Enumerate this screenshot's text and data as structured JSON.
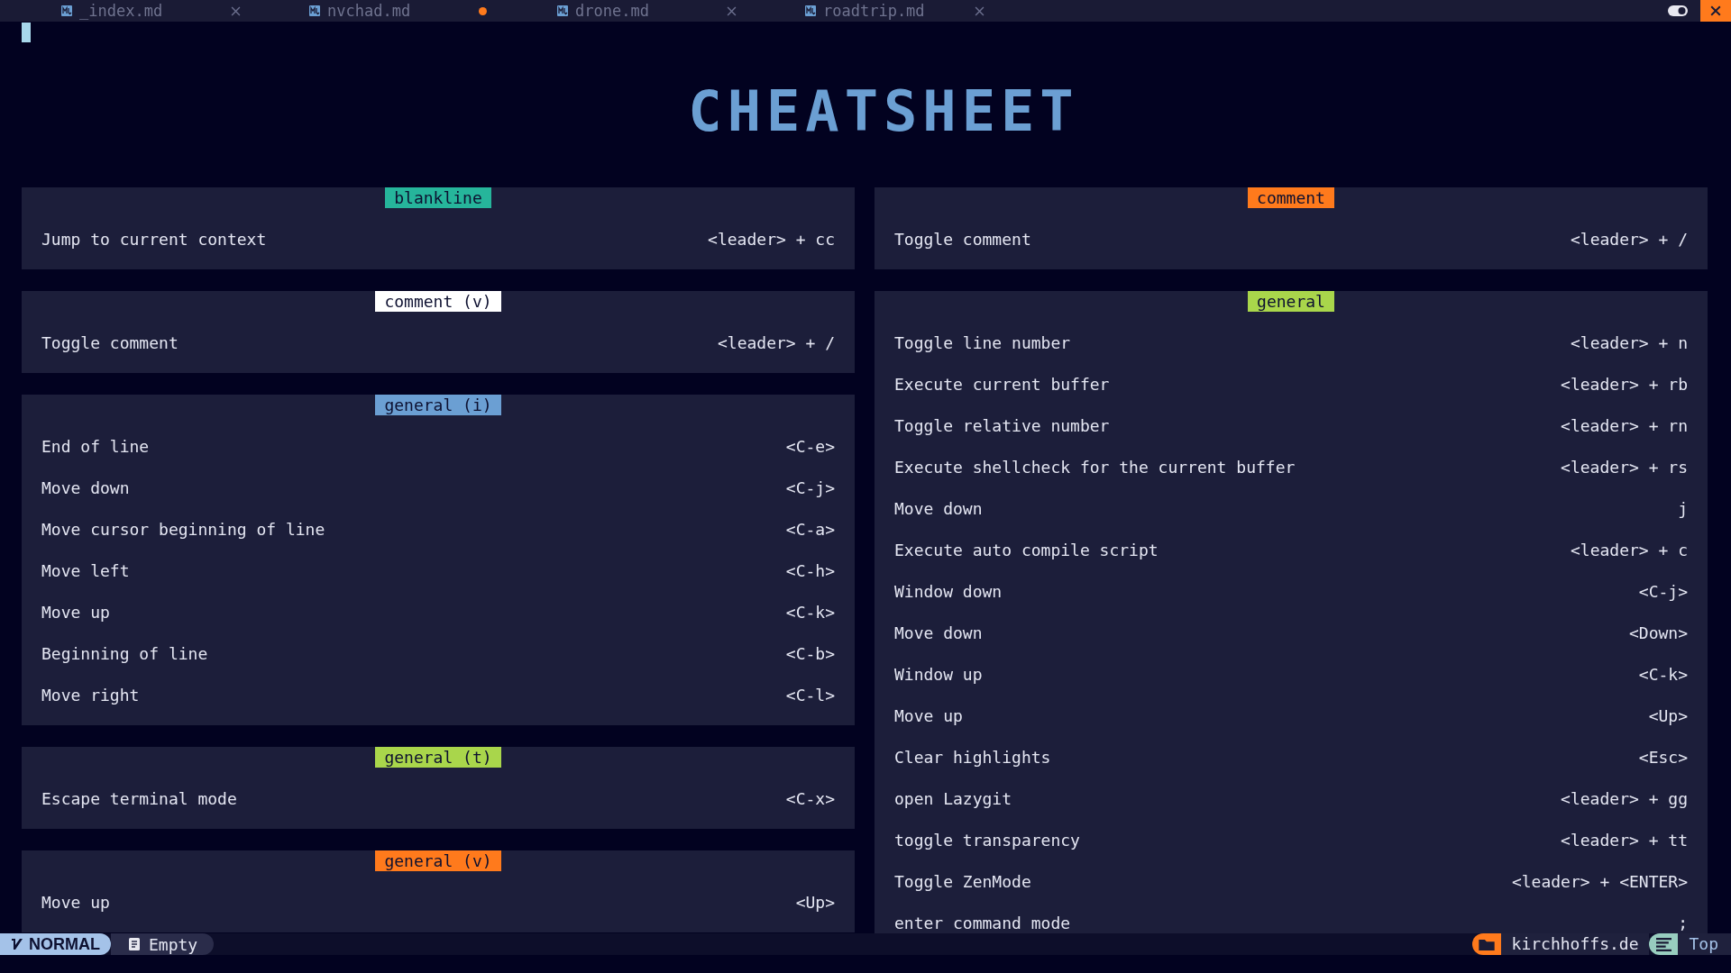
{
  "tabs": [
    {
      "label": "_index.md",
      "modified": false
    },
    {
      "label": "nvchad.md",
      "modified": true
    },
    {
      "label": "drone.md",
      "modified": false
    },
    {
      "label": "roadtrip.md",
      "modified": false
    }
  ],
  "title": "CHEATSHEET",
  "columns": [
    [
      {
        "header": "blankline",
        "color": "#26b59b",
        "rows": [
          {
            "action": "Jump to current context",
            "keys": "<leader> + cc"
          }
        ]
      },
      {
        "header": "comment (v)",
        "color": "#ffffff",
        "rows": [
          {
            "action": "Toggle comment",
            "keys": "<leader> + /"
          }
        ]
      },
      {
        "header": "general (i)",
        "color": "#6b9fd3",
        "rows": [
          {
            "action": "End of line",
            "keys": "<C-e>"
          },
          {
            "action": "Move down",
            "keys": "<C-j>"
          },
          {
            "action": "Move cursor beginning of line",
            "keys": "<C-a>"
          },
          {
            "action": "Move left",
            "keys": "<C-h>"
          },
          {
            "action": "Move up",
            "keys": "<C-k>"
          },
          {
            "action": "Beginning of line",
            "keys": "<C-b>"
          },
          {
            "action": "Move right",
            "keys": "<C-l>"
          }
        ]
      },
      {
        "header": "general (t)",
        "color": "#a9d64b",
        "rows": [
          {
            "action": "Escape terminal mode",
            "keys": "<C-x>"
          }
        ]
      },
      {
        "header": "general (v)",
        "color": "#ff7a1c",
        "rows": [
          {
            "action": "Move up",
            "keys": "<Up>"
          }
        ]
      }
    ],
    [
      {
        "header": "comment",
        "color": "#ff7a1c",
        "rows": [
          {
            "action": "Toggle comment",
            "keys": "<leader> + /"
          }
        ]
      },
      {
        "header": "general",
        "color": "#a9d64b",
        "rows": [
          {
            "action": "Toggle line number",
            "keys": "<leader> + n"
          },
          {
            "action": "Execute current buffer",
            "keys": "<leader> + rb"
          },
          {
            "action": "Toggle relative number",
            "keys": "<leader> + rn"
          },
          {
            "action": "Execute shellcheck for the current buffer",
            "keys": "<leader> + rs"
          },
          {
            "action": "Move down",
            "keys": "j"
          },
          {
            "action": "Execute auto compile script",
            "keys": "<leader> + c"
          },
          {
            "action": "Window down",
            "keys": "<C-j>"
          },
          {
            "action": "Move down",
            "keys": "<Down>"
          },
          {
            "action": "Window up",
            "keys": "<C-k>"
          },
          {
            "action": "Move up",
            "keys": "<Up>"
          },
          {
            "action": "Clear highlights",
            "keys": "<Esc>"
          },
          {
            "action": "open Lazygit",
            "keys": "<leader> + gg"
          },
          {
            "action": "toggle transparency",
            "keys": "<leader> + tt"
          },
          {
            "action": "Toggle ZenMode",
            "keys": "<leader> + <ENTER>"
          },
          {
            "action": "enter command mode",
            "keys": ";"
          }
        ]
      }
    ]
  ],
  "status_bar": {
    "mode": "NORMAL",
    "file": "Empty",
    "directory": "kirchhoffs.de",
    "position": "Top"
  }
}
